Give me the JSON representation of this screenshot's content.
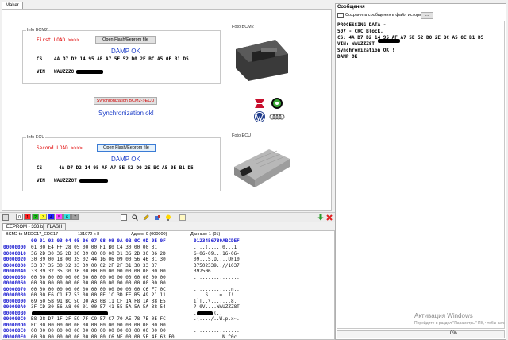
{
  "main_tab": {
    "label": "Maker"
  },
  "bcm2": {
    "legend": "Info BCM2",
    "first_load_label": "First LOAD >>>>",
    "open_button": "Open Flash/Eeprom file",
    "status": "DAMP OK",
    "cs_label": "CS",
    "cs_value": "4A D7 D2 14 95 AF A7 5E 52 D0 2E BC A5 0E B1 D5",
    "vin_label": "VIN",
    "vin_value": "WAUZZZ8"
  },
  "photo_bcm2": {
    "label": "Foto BCM2"
  },
  "sync": {
    "button": "Synchronization BCM2->ECU",
    "status": "Synchronization ok!"
  },
  "brands": [
    "SEAT",
    "SKODA",
    "VW",
    "Audi"
  ],
  "ecu": {
    "legend": "Info ECU",
    "second_load_label": "Second LOAD >>>>",
    "open_button": "Open Flash/Eeprom file",
    "status": "DAMP OK",
    "cs_label": "CS",
    "cs_value": "4A D7 D2 14 95 AF A7 5E 52 D0 2E BC A5 0E B1 D5",
    "vin_label": "VIN",
    "vin_value": "WAUZZZ8T"
  },
  "photo_ecu": {
    "label": "Foto ECU"
  },
  "toolbar": {
    "chips": [
      {
        "label": "0",
        "color": "#ffffff"
      },
      {
        "label": "1",
        "color": "#ff2020"
      },
      {
        "label": "2",
        "color": "#20c020"
      },
      {
        "label": "3",
        "color": "#ffff30"
      },
      {
        "label": "4",
        "color": "#2020ff"
      },
      {
        "label": "5",
        "color": "#ff40ff"
      },
      {
        "label": "6",
        "color": "#30e0e0"
      },
      {
        "label": "7",
        "color": "#a0a0a0"
      }
    ]
  },
  "hex_tabs": [
    "EEPROM - 333.bin",
    "FLASH"
  ],
  "hex_info": {
    "description": "BCM2 to MEDC17_EDC17",
    "size": "131072 x 8",
    "address": "Адрес: 0 (000000)",
    "data": "Данные: 1 (01)"
  },
  "hex_header": {
    "cols": "00 01 02 03 04 05 06 07 08 09 0A 0B 0C 0D 0E 0F",
    "ascii": "0123456789ABCDEF"
  },
  "hex_rows": [
    {
      "off": "00000000",
      "hex": "01 00 E4 FF 28 05 00 00 F1 B0 C4 30 00 00 31",
      "asc": "....(.....0...1"
    },
    {
      "off": "00000010",
      "hex": "36 2D 30 36 2D 30 39 00 00 00 31 36 2D 30 36 2D",
      "asc": "6-06-09...16-06-"
    },
    {
      "off": "00000020",
      "hex": "30 39 00 18 00 35 02 44 16 06 09 00 56 46 31 30",
      "asc": "09...5.D....UF10"
    },
    {
      "off": "00000030",
      "hex": "33 37 35 30 32 33 39 00 02 2F 2F 31 30 33 37",
      "asc": "37502339..//1037"
    },
    {
      "off": "00000040",
      "hex": "33 39 32 35 30 36 00 00 00 00 00 00 00 00 00 00",
      "asc": "392506.........."
    },
    {
      "off": "00000050",
      "hex": "00 00 00 00 00 00 00 00 00 00 00 00 00 00 00 00",
      "asc": "................"
    },
    {
      "off": "00000060",
      "hex": "00 00 00 00 00 00 00 00 00 00 00 00 00 00 00 00",
      "asc": "................"
    },
    {
      "off": "00000070",
      "hex": "00 00 00 00 00 00 00 00 00 00 00 00 00 C6 F7 0C",
      "asc": ".............n.."
    },
    {
      "off": "00000080",
      "hex": "00 00 E6 C1 E7 53 00 00 FE 1C 3D FE B5 49 21 11",
      "asc": "....S....=..I!."
    },
    {
      "off": "00000090",
      "hex": "69 60 5B 91 BC 5C D0 A3 0B 11 CF 1A F8 1A 38 E5",
      "asc": "i`[..\\.......8."
    },
    {
      "off": "000000A0",
      "hex": "3F CD 30 56 A8 00 01 00 57 41 55 5A 5A 5A 38 54",
      "asc": "?.0V....WAUZZZ8T"
    },
    {
      "off": "000000B0",
      "hex": "",
      "asc": "...[xx.(.."
    },
    {
      "off": "000000C0",
      "hex": "B8 28 D7 1F 2F E9 7F C9 57 C7 70 AE 78 7E 0E FC",
      "asc": ".(..../..W.p.x~.."
    },
    {
      "off": "000000D0",
      "hex": "EC 00 00 00 00 00 00 00 00 00 00 00 00 00 00 00",
      "asc": "................"
    },
    {
      "off": "000000E0",
      "hex": "00 00 00 00 00 00 00 00 00 00 00 00 00 00 00 00",
      "asc": "................"
    },
    {
      "off": "000000F0",
      "hex": "00 00 00 00 00 00 00 00 00 C6 NE 00 00 5E 4F 63 E0",
      "asc": "..........N.^0c."
    }
  ],
  "messages": {
    "title": "Сообщения",
    "save_checkbox": "Сохранять сообщения в файл истории",
    "browse_button": "...",
    "lines": [
      "PROCESSING DATA -",
      "507 - CRC Block.",
      "CS: 4A D7 D2 14 95 AF A7 5E 52 D0 2E BC A5 0E B1 D5",
      "VIN: WAUZZZ8T",
      "Synchronization OK !",
      "DAMP OK"
    ],
    "watermark_title": "Активация Windows",
    "watermark_sub": "Перейдите в раздел \"Параметры\" ПК, чтобы активиро...",
    "status_percent": "0%"
  }
}
